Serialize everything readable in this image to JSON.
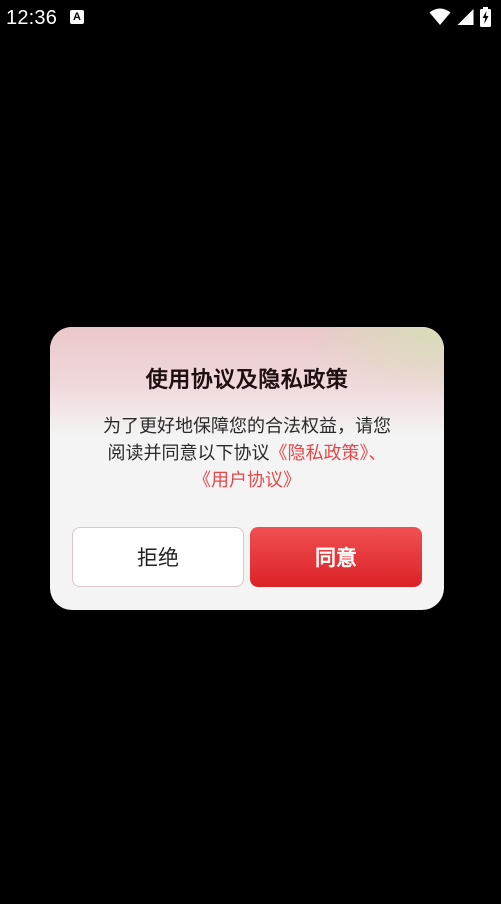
{
  "status_bar": {
    "time": "12:36",
    "notification_glyph": "A",
    "icons": [
      "wifi-icon",
      "cellular-signal-icon",
      "battery-charging-icon"
    ]
  },
  "dialog": {
    "title": "使用协议及隐私政策",
    "message_line1": "为了更好地保障您的合法权益，请您",
    "message_line2_text": "阅读并同意以下协议",
    "privacy_link": "《隐私政策》",
    "separator": "、",
    "user_agreement_link": "《用户协议》",
    "reject_label": "拒绝",
    "agree_label": "同意"
  },
  "colors": {
    "background": "#000000",
    "dialog_background": "#f4f4f4",
    "link": "#e4494b",
    "primary_button": "#e02a2d",
    "title": "#1f0f10"
  }
}
